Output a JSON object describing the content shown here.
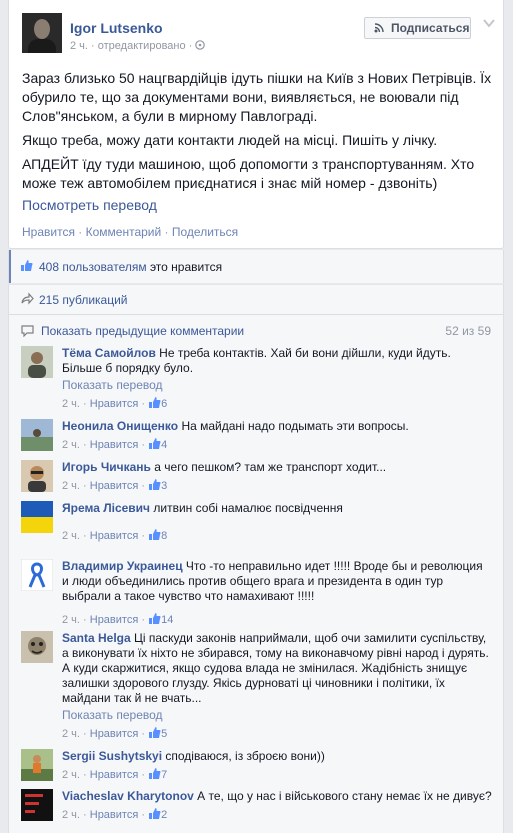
{
  "post": {
    "author": "Igor Lutsenko",
    "time": "2 ч.",
    "edited": "отредактировано",
    "subscribe_label": "Подписаться",
    "paragraphs": [
      "Зараз близько 50 нацгвардійців ідуть пішки на Київ з Нових Петрівців. Їх обурило те, що за документами вони, виявляється, не воювали під Слов\"янськом, а були в мирному Павлограді.",
      "Якщо треба, можу дати контакти людей на місці. Пишіть у лічку.",
      "АПДЕЙТ їду туди машиною, щоб допомогти з транспортуванням. Хто може теж автомобілем приєднатися і знає мій номер - дзвоніть)"
    ],
    "translate_label": "Посмотреть перевод",
    "actions": {
      "like": "Нравится",
      "comment": "Комментарий",
      "share": "Поделиться",
      "sep": " · "
    }
  },
  "likes": {
    "count_text": "408 пользователям",
    "suffix": " это нравится"
  },
  "shares": {
    "text": "215 публикаций"
  },
  "comments_header": {
    "prev_label": "Показать предыдущие комментарии",
    "count": "52 из 59"
  },
  "comments": [
    {
      "name": "Тёма Самойлов",
      "text": " Не треба контактів. Хай би вони дійшли, куди йдуть. Більше б порядку було.",
      "translate": "Показать перевод",
      "time": "2 ч.",
      "like": "Нравится",
      "likes": "6",
      "avatar_color": "#7a8a6a"
    },
    {
      "name": "Неонила Онищенко",
      "text": " На майдані надо подымать эти вопросы.",
      "translate": "",
      "time": "2 ч.",
      "like": "Нравится",
      "likes": "4",
      "avatar_color": "#6e8fb5"
    },
    {
      "name": "Игорь Чичкань",
      "text": " а чего пешком? там же транспорт ходит...",
      "translate": "",
      "time": "2 ч.",
      "like": "Нравится",
      "likes": "3",
      "avatar_color": "#b58a5a"
    },
    {
      "name": "Ярема Лісевич",
      "text": " литвин собі намалює посвідчення",
      "translate": "",
      "time": "2 ч.",
      "like": "Нравится",
      "likes": "8",
      "avatar_color": "#f4d40a"
    },
    {
      "name": "Владимир Украинец",
      "text": " Что -то неправильно идет !!!!! Вроде бы и революция и люди объединились против общего врага и президента в один тур выбрали а такое чувство что намахивают !!!!!",
      "translate": "",
      "time": "2 ч.",
      "like": "Нравится",
      "likes": "14",
      "avatar_color": "#ffffff"
    },
    {
      "name": "Santa Helga",
      "text": " Ці паскуди законів наприймали, щоб очи замилити суспільству, а виконувати їх ніхто не збирався, тому на виконавчому рівні народ і дурять. А куди скаржитися, якщо судова влада не змінилася. Жадібність знищує залишки здорового глузду. Якісь дурноваті ці чиновники і політики, їх майдани так й не вчать...",
      "translate": "Показать перевод",
      "time": "2 ч.",
      "like": "Нравится",
      "likes": "5",
      "avatar_color": "#a89c8a"
    },
    {
      "name": "Sergii Sushytskyi",
      "text": " сподіваюся, із зброєю вони))",
      "translate": "",
      "time": "2 ч.",
      "like": "Нравится",
      "likes": "7",
      "avatar_color": "#5d7a45"
    },
    {
      "name": "Viacheslav Kharytonov",
      "text": " А те, що у нас і військового стану немає їх не дивує?",
      "translate": "",
      "time": "2 ч.",
      "like": "Нравится",
      "likes": "2",
      "avatar_color": "#111111"
    }
  ],
  "colors": {
    "link": "#3b5998",
    "muted": "#9197a3",
    "bg": "#e9eaed"
  }
}
